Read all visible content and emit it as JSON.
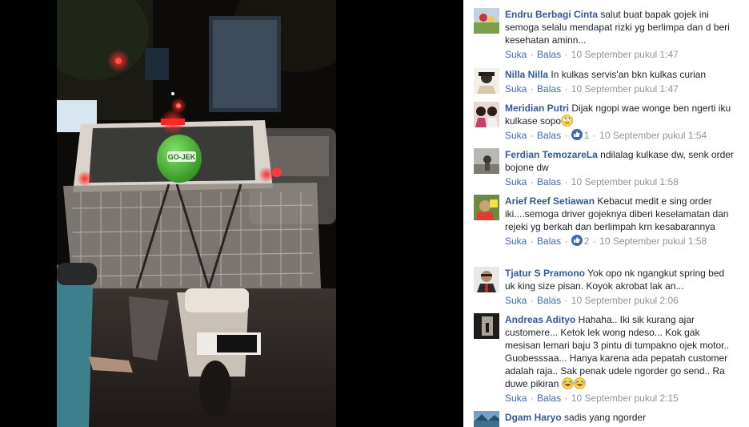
{
  "comments": [
    {
      "author": "Endru Berbagi Cinta",
      "text": "salut buat bapak gojek ini semoga selalu mendapat rizki yg berlimpa dan d beri kesehatan aminn...",
      "like": "Suka",
      "reply": "Balas",
      "time": "10 September pukul 1:47"
    },
    {
      "author": "Nilla Nilla",
      "text": "In kulkas servis'an bkn kulkas curian",
      "like": "Suka",
      "reply": "Balas",
      "time": "10 September pukul 1:47"
    },
    {
      "author": "Meridian Putri",
      "text": "Dijak ngopi wae wonge ben ngerti iku kulkase sopo",
      "emoji": "rolling-eyes-emoji",
      "like": "Suka",
      "reply": "Balas",
      "likes": "1",
      "time": "10 September pukul 1:54"
    },
    {
      "author": "Ferdian TemozareLa",
      "text": "ndilalag kulkase dw, senk order bojone dw",
      "like": "Suka",
      "reply": "Balas",
      "time": "10 September pukul 1:58"
    },
    {
      "author": "Arief Reef Setiawan",
      "text": "Kebacut medit e sing order iki....semoga driver gojeknya diberi keselamatan dan rejeki yg berkah dan berlimpah krn kesabarannya",
      "like": "Suka",
      "reply": "Balas",
      "likes": "2",
      "time": "10 September pukul 1:58"
    },
    {
      "author": "Tjatur S Pramono",
      "text": "Yok opo nk ngangkut spring bed uk king size pisan. Koyok akrobat lak an...",
      "like": "Suka",
      "reply": "Balas",
      "time": "10 September pukul 2:06"
    },
    {
      "author": "Andreas Adityo",
      "text": "Hahaha.. Iki sik kurang ajar customere... Ketok lek wong ndeso... Kok gak mesisan lemari baju 3 pintu di tumpakno ojek motor.. Guobesssaa... Hanya karena ada pepatah customer adalah raja.. Sak penak udele ngorder go send.. Ra duwe pikiran",
      "emoji": "laughing-emoji",
      "like": "Suka",
      "reply": "Balas",
      "time": "10 September pukul 2:15"
    },
    {
      "author": "Dgam Haryo",
      "text": "sadis yang ngorder"
    }
  ],
  "photo": {
    "helmet_text": "GO-JEK"
  },
  "colors": {
    "author": "#365899",
    "link": "#4267b2",
    "meta": "#90949c",
    "text": "#1d2129",
    "theater": "#000000"
  }
}
